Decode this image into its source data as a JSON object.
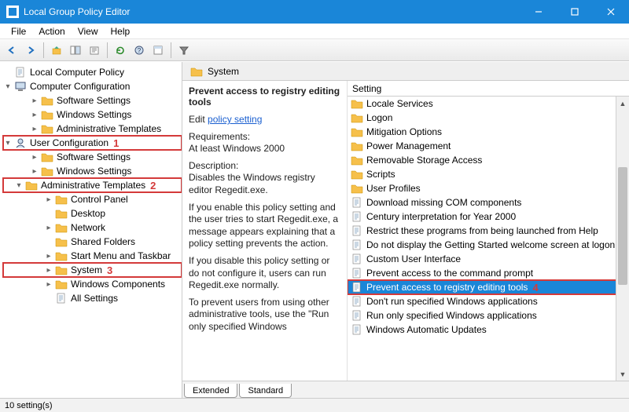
{
  "window": {
    "title": "Local Group Policy Editor"
  },
  "menus": [
    "File",
    "Action",
    "View",
    "Help"
  ],
  "toolbar_icons": [
    "back",
    "forward",
    "up",
    "show-hide-tree",
    "export",
    "refresh",
    "help",
    "properties",
    "filter"
  ],
  "tree": [
    {
      "ind": 0,
      "twist": "",
      "icon": "doc",
      "label": "Local Computer Policy"
    },
    {
      "ind": 0,
      "twist": "v",
      "icon": "pc",
      "label": "Computer Configuration"
    },
    {
      "ind": 2,
      "twist": ">",
      "icon": "folder",
      "label": "Software Settings"
    },
    {
      "ind": 2,
      "twist": ">",
      "icon": "folder",
      "label": "Windows Settings"
    },
    {
      "ind": 2,
      "twist": ">",
      "icon": "folder",
      "label": "Administrative Templates"
    },
    {
      "ind": 0,
      "twist": "v",
      "icon": "user",
      "label": "User Configuration",
      "hl": true,
      "marker": "1"
    },
    {
      "ind": 2,
      "twist": ">",
      "icon": "folder",
      "label": "Software Settings"
    },
    {
      "ind": 2,
      "twist": ">",
      "icon": "folder",
      "label": "Windows Settings"
    },
    {
      "ind": 1,
      "twist": "v",
      "icon": "folder",
      "label": "Administrative Templates",
      "hl": true,
      "marker": "2"
    },
    {
      "ind": 3,
      "twist": ">",
      "icon": "folder",
      "label": "Control Panel"
    },
    {
      "ind": 3,
      "twist": "",
      "icon": "folder",
      "label": "Desktop"
    },
    {
      "ind": 3,
      "twist": ">",
      "icon": "folder",
      "label": "Network"
    },
    {
      "ind": 3,
      "twist": "",
      "icon": "folder",
      "label": "Shared Folders"
    },
    {
      "ind": 3,
      "twist": ">",
      "icon": "folder",
      "label": "Start Menu and Taskbar"
    },
    {
      "ind": 3,
      "twist": ">",
      "icon": "folder",
      "label": "System",
      "hl": true,
      "marker": "3"
    },
    {
      "ind": 3,
      "twist": ">",
      "icon": "folder",
      "label": "Windows Components"
    },
    {
      "ind": 3,
      "twist": "",
      "icon": "doc",
      "label": "All Settings"
    }
  ],
  "heading": "System",
  "extended": {
    "title": "Prevent access to registry editing tools",
    "edit_link_prefix": "Edit ",
    "edit_link_text": "policy setting",
    "req_label": "Requirements:",
    "req_value": "At least Windows 2000",
    "desc_label": "Description:",
    "desc_p1": "Disables the Windows registry editor Regedit.exe.",
    "desc_p2": "If you enable this policy setting and the user tries to start Regedit.exe, a message appears explaining that a policy setting prevents the action.",
    "desc_p3": "If you disable this policy setting or do not configure it, users can run Regedit.exe normally.",
    "desc_p4": "To prevent users from using other administrative tools, use the \"Run only specified Windows"
  },
  "list_header": "Setting",
  "list": [
    {
      "icon": "folder",
      "label": "Locale Services"
    },
    {
      "icon": "folder",
      "label": "Logon"
    },
    {
      "icon": "folder",
      "label": "Mitigation Options"
    },
    {
      "icon": "folder",
      "label": "Power Management"
    },
    {
      "icon": "folder",
      "label": "Removable Storage Access"
    },
    {
      "icon": "folder",
      "label": "Scripts"
    },
    {
      "icon": "folder",
      "label": "User Profiles"
    },
    {
      "icon": "doc",
      "label": "Download missing COM components"
    },
    {
      "icon": "doc",
      "label": "Century interpretation for Year 2000"
    },
    {
      "icon": "doc",
      "label": "Restrict these programs from being launched from Help"
    },
    {
      "icon": "doc",
      "label": "Do not display the Getting Started welcome screen at logon"
    },
    {
      "icon": "doc",
      "label": "Custom User Interface"
    },
    {
      "icon": "doc",
      "label": "Prevent access to the command prompt"
    },
    {
      "icon": "doc",
      "label": "Prevent access to registry editing tools",
      "selected": true,
      "hl": true,
      "marker": "4"
    },
    {
      "icon": "doc",
      "label": "Don't run specified Windows applications"
    },
    {
      "icon": "doc",
      "label": "Run only specified Windows applications"
    },
    {
      "icon": "doc",
      "label": "Windows Automatic Updates"
    }
  ],
  "tabs": [
    "Extended",
    "Standard"
  ],
  "active_tab": "Extended",
  "status": "10 setting(s)",
  "colors": {
    "accent": "#1a86d8",
    "hl": "#d43a3a"
  }
}
